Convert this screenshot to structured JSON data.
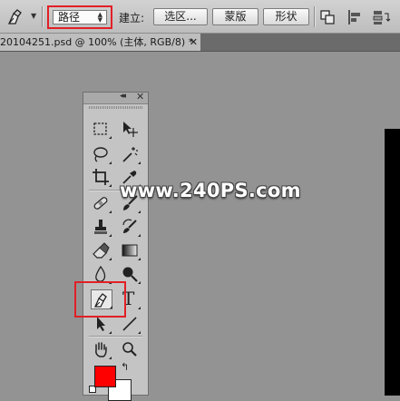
{
  "options_bar": {
    "mode_value": "路径",
    "build_label": "建立:",
    "buttons": {
      "selection": "选区...",
      "mask": "蒙版",
      "shape": "形状"
    }
  },
  "document": {
    "tab_title": "20104251.psd @ 100% (主体, RGB/8) *",
    "close_glyph": "✕"
  },
  "tools_panel": {
    "collapse_glyph": "◂◂",
    "close_glyph": "✕",
    "type_tool_glyph": "T"
  },
  "colors": {
    "foreground": "#ff0000",
    "background": "#ffffff",
    "highlight": "#e21f26"
  },
  "watermark": "www.240PS.com"
}
